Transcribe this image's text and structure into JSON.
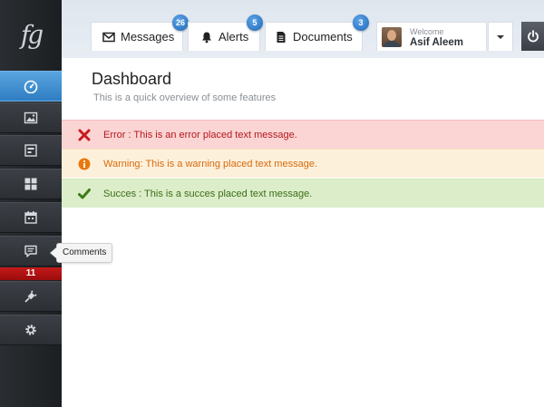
{
  "app": {
    "logo_text": "fg"
  },
  "sidebar": {
    "items": [
      {
        "name": "dashboard",
        "icon": "gauge-icon"
      },
      {
        "name": "gallery",
        "icon": "image-icon"
      },
      {
        "name": "forms",
        "icon": "form-icon"
      },
      {
        "name": "widgets",
        "icon": "grid-icon"
      },
      {
        "name": "calendar",
        "icon": "calendar-icon"
      },
      {
        "name": "comments",
        "icon": "chat-icon",
        "tooltip": "Comments",
        "badge": "11"
      },
      {
        "name": "plugins",
        "icon": "plug-icon"
      },
      {
        "name": "settings",
        "icon": "gear-icon"
      }
    ]
  },
  "header": {
    "tabs": [
      {
        "label": "Messages",
        "count": "26",
        "icon": "envelope-icon"
      },
      {
        "label": "Alerts",
        "count": "5",
        "icon": "bell-icon"
      },
      {
        "label": "Documents",
        "count": "3",
        "icon": "document-icon"
      }
    ],
    "user": {
      "welcome": "Welcome",
      "name": "Asif Aleem"
    }
  },
  "main": {
    "title": "Dashboard",
    "subtitle": "This is a quick overview of some features"
  },
  "alerts": {
    "error": "Error : This is an error placed text message.",
    "warning": "Warning: This is a warning placed text message.",
    "success": "Succes : This is a succes placed text message."
  },
  "colors": {
    "accent": "#3a88cc",
    "sidebar": "#25282c",
    "error_bg": "#fbd4d4",
    "warning_bg": "#fdf0db",
    "success_bg": "#dcedc9"
  }
}
